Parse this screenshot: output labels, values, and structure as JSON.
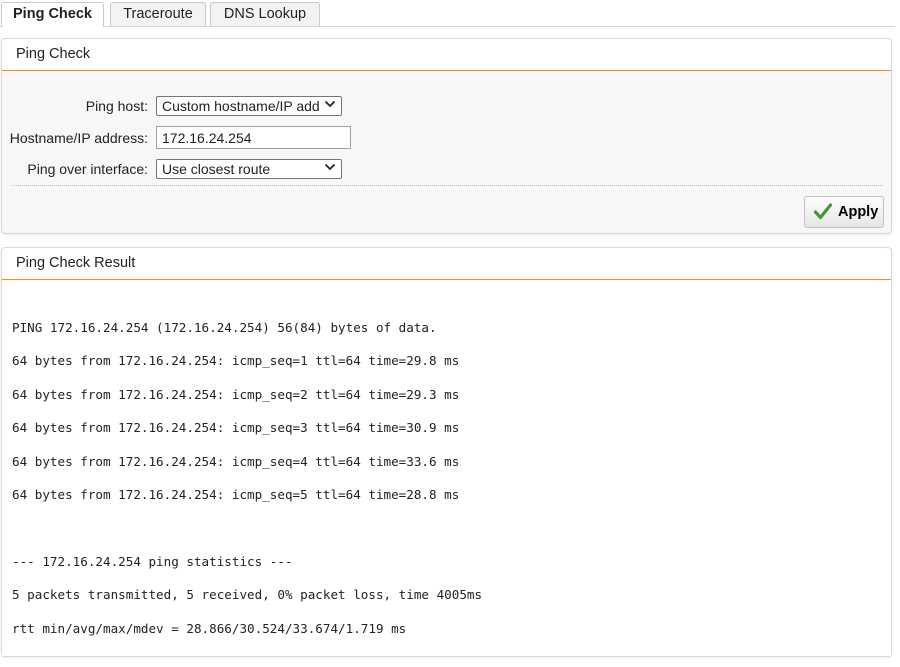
{
  "tabs": [
    {
      "label": "Ping Check",
      "active": true
    },
    {
      "label": "Traceroute",
      "active": false
    },
    {
      "label": "DNS Lookup",
      "active": false
    }
  ],
  "ping_panel": {
    "title": "Ping Check",
    "ping_host_label": "Ping host:",
    "ping_host_value": "Custom hostname/IP address",
    "hostname_label": "Hostname/IP address:",
    "hostname_value": "172.16.24.254",
    "interface_label": "Ping over interface:",
    "interface_value": "Use closest route",
    "apply_label": "Apply"
  },
  "result_panel": {
    "title": "Ping Check Result",
    "lines": [
      "PING 172.16.24.254 (172.16.24.254) 56(84) bytes of data.",
      "64 bytes from 172.16.24.254: icmp_seq=1 ttl=64 time=29.8 ms",
      "64 bytes from 172.16.24.254: icmp_seq=2 ttl=64 time=29.3 ms",
      "64 bytes from 172.16.24.254: icmp_seq=3 ttl=64 time=30.9 ms",
      "64 bytes from 172.16.24.254: icmp_seq=4 ttl=64 time=33.6 ms",
      "64 bytes from 172.16.24.254: icmp_seq=5 ttl=64 time=28.8 ms",
      "",
      "--- 172.16.24.254 ping statistics ---",
      "5 packets transmitted, 5 received, 0% packet loss, time 4005ms",
      "rtt min/avg/max/mdev = 28.866/30.524/33.674/1.719 ms"
    ]
  },
  "colors": {
    "accent_orange": "#f08a24",
    "apply_check_green": "#3c9a2e"
  },
  "icons": {
    "apply": "checkmark-icon",
    "dropdown": "chevron-down-icon"
  }
}
